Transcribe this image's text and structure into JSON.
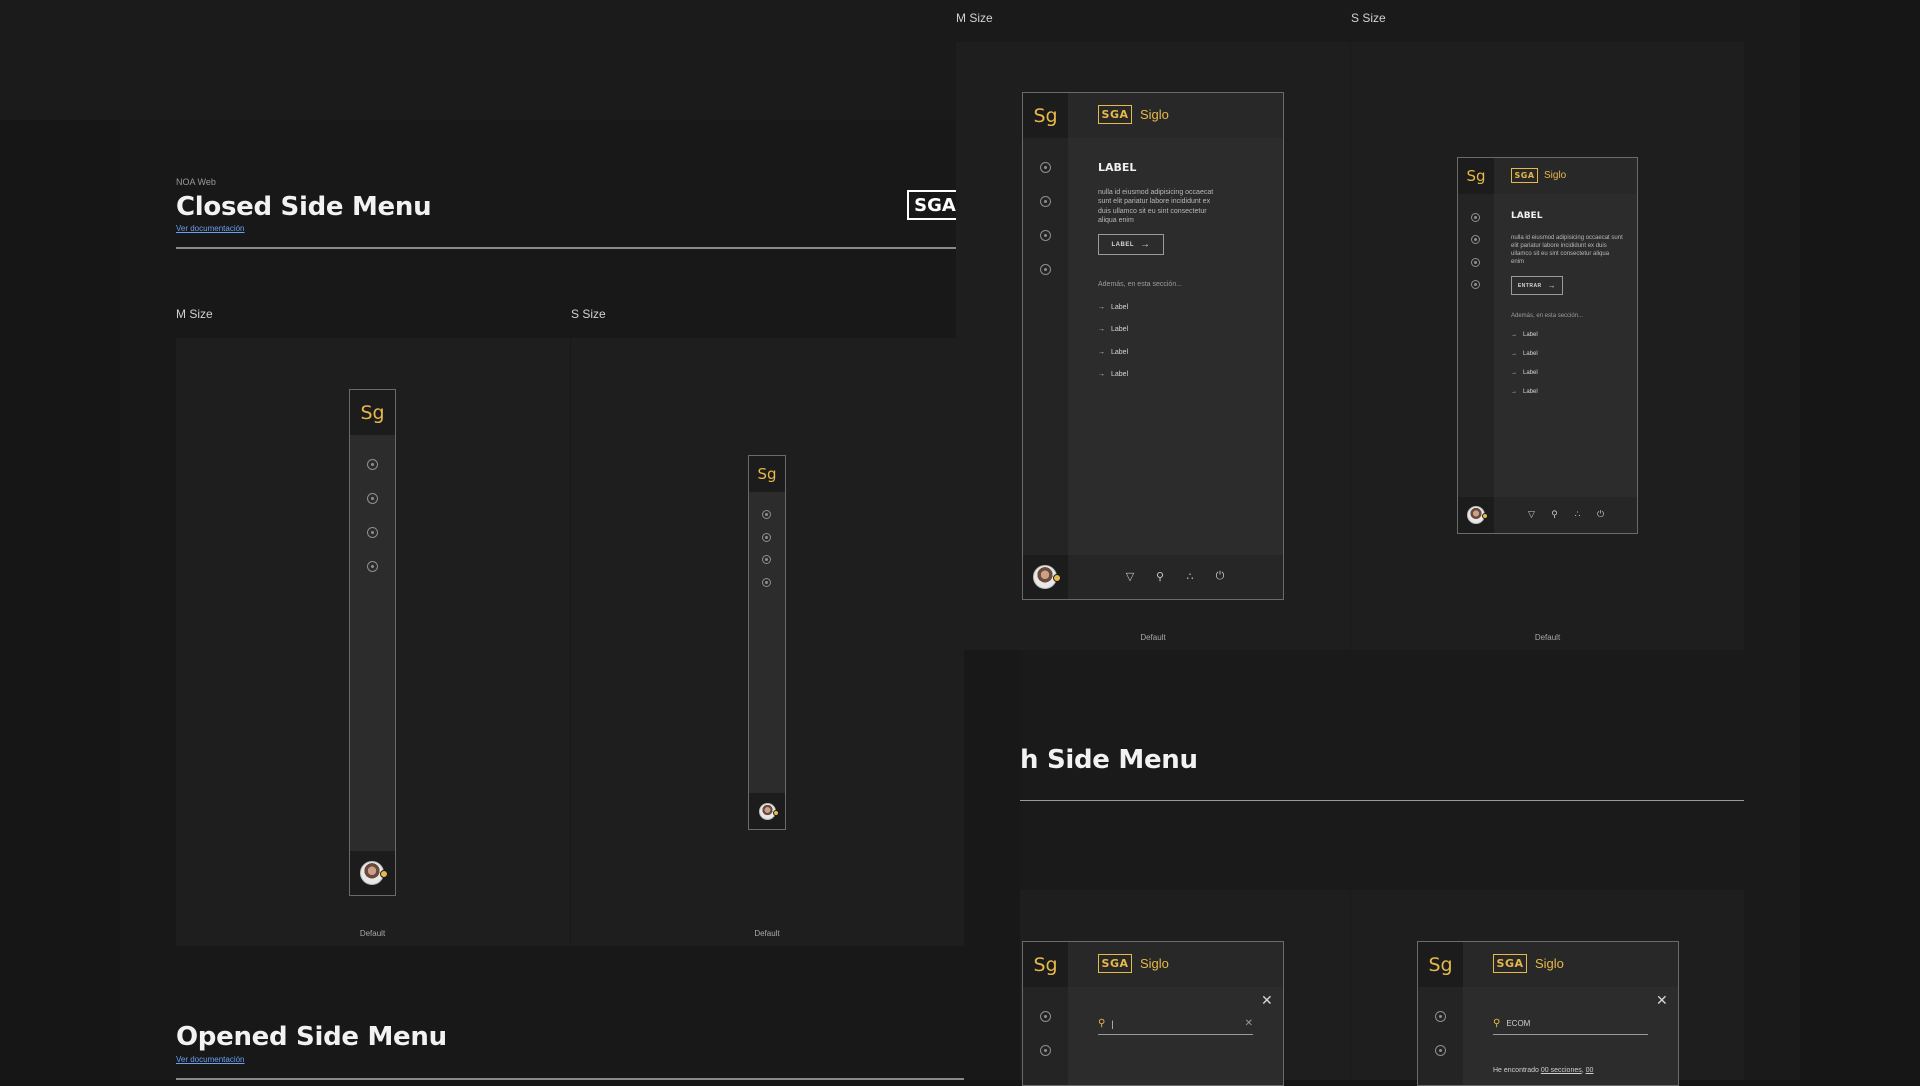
{
  "colors": {
    "accent": "#e7b84a",
    "link": "#6b9ff0",
    "background": "#161616",
    "panel": "#1a1a1a"
  },
  "closed": {
    "breadcrumb": "NOA Web",
    "title": "Closed Side Menu",
    "doc_link": "Ver documentación",
    "logo": "SGA",
    "m_label": "M Size",
    "s_label": "S Size",
    "m_caption": "Default",
    "s_caption": "Default"
  },
  "opened": {
    "title": "Opened Side Menu",
    "doc_link": "Ver documentación"
  },
  "right": {
    "m_label": "M Size",
    "s_label": "S Size",
    "m_caption": "Default",
    "s_caption": "Default",
    "search_title_partial": "h Side Menu"
  },
  "menu": {
    "logo_short": "Sg",
    "brand_box": "SGA",
    "brand_name": "Siglo",
    "content_label": "LABEL",
    "body_text": "nulla id eiusmod adipisicing occaecat sunt elit pariatur labore incididunt ex duis ullamco sit eu sint consectetur aliqua enim",
    "button_label_m": "LABEL",
    "button_label_s": "ENTRAR",
    "also_text": "Además, en esta sección...",
    "links": [
      "Label",
      "Label",
      "Label",
      "Label"
    ],
    "nav_icons": [
      "target-icon",
      "target-icon",
      "target-icon",
      "target-icon"
    ],
    "footer_icons": [
      "bell-icon",
      "search-icon",
      "apps-icon",
      "power-icon"
    ]
  },
  "search": {
    "empty_value": "|",
    "filled_value": "ECOM",
    "result_prefix": "He encontrado",
    "result_sections": "00 secciones",
    "result_suffix": "00"
  }
}
